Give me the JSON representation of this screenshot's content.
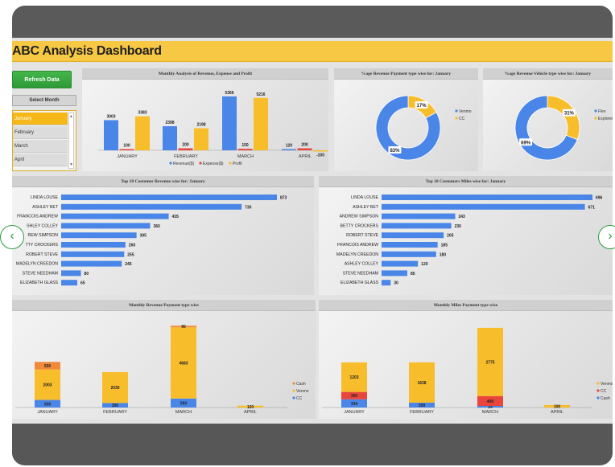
{
  "dashboard": {
    "title": "ABC Analysis Dashboard",
    "refresh_label": "Refresh Data",
    "select_month_label": "Select Month",
    "slicer_items": [
      "January",
      "February",
      "March",
      "April"
    ],
    "selected_month": "January"
  },
  "nav": {
    "prev_icon": "chevron-left-icon",
    "next_icon": "chevron-right-icon",
    "prev_glyph": "‹",
    "next_glyph": "›"
  },
  "colors": {
    "title_bar": "#f7c843",
    "blue": "#4a86e8",
    "yellow": "#f8bd2b",
    "red": "#e8453c",
    "orange": "#f08a3a",
    "green": "#3aa845"
  },
  "charts": {
    "monthly": {
      "title": "Monthly Analysis of Revenue, Expense and Profit",
      "type": "bar",
      "categories": [
        "JANUARY",
        "FEBRUARY",
        "MARCH",
        "APRIL"
      ],
      "series": [
        {
          "name": "Revenue($)",
          "values": [
            3003,
            2398,
            5366,
            120
          ],
          "labels": [
            "3003",
            "2398",
            "5366",
            "120"
          ]
        },
        {
          "name": "Expense($)",
          "values": [
            100,
            200,
            150,
            200
          ],
          "labels": [
            "100",
            "200",
            "150",
            "200"
          ]
        },
        {
          "name": "Profit",
          "values": [
            3383,
            2198,
            5216,
            -100
          ],
          "labels": [
            "3383",
            "2198",
            "5216",
            "-100"
          ]
        }
      ],
      "ylim": [
        -200,
        5600
      ]
    },
    "payment_donut": {
      "title": "%age Revenue Payment type wise for: January",
      "type": "pie",
      "slices": [
        {
          "name": "CC",
          "value": 17,
          "label": "17%"
        },
        {
          "name": "Venmo",
          "value": 83,
          "label": "83%"
        }
      ],
      "legend": [
        "Venmo",
        "CC"
      ]
    },
    "vehicle_donut": {
      "title": "%age Revenue Vehicle type wise for: January",
      "type": "pie",
      "slices": [
        {
          "name": "Explorer",
          "value": 31,
          "label": "31%"
        },
        {
          "name": "Flex",
          "value": 69,
          "label": "69%"
        }
      ],
      "legend": [
        "Flex",
        "Explorer"
      ]
    },
    "top_revenue": {
      "title": "Top 10 Customer Revenue wise for: January",
      "type": "bar",
      "categories": [
        "LINDA LOUSE",
        "ASHLEY BET",
        "FRANCOIS ANDREW",
        "ASHLEY COLLEY",
        "ANDREW SIMPSON",
        "BETTY CROCKERS",
        "ROBERT STEVE",
        "MADELYN CREEDON",
        "STEVE NEEDHAM",
        "ELIZABETH GLASS"
      ],
      "display_names": [
        "LINDA LOUSE",
        "ASHLEY BET",
        "FRANCOIS ANDREW",
        "SHLEY COLLEY",
        "REW SIMPSON",
        "TTY CROCKERS",
        "ROBERT STEVE",
        "MADELYN CREEDON",
        "STEVE NEEDHAM",
        "ELIZABETH GLASS"
      ],
      "values": [
        873,
        730,
        435,
        360,
        305,
        260,
        255,
        245,
        80,
        65
      ],
      "labels": [
        "873",
        "730",
        "435",
        "360",
        "305",
        "260",
        "255",
        "245",
        "80",
        "65"
      ]
    },
    "top_miles": {
      "title": "Top 10 Customers Miles wise for: January",
      "type": "bar",
      "categories": [
        "LINDA LOUSE",
        "ASHLEY BET",
        "ANDREW SIMPSON",
        "BETTY CROCKERS",
        "ROBERT STEVE",
        "FRANCOIS ANDREW",
        "MADELYN CREEDON",
        "ASHLEY COLLEY",
        "STEVE NEEDHAM",
        "ELIZABETH GLASS"
      ],
      "values": [
        696,
        671,
        243,
        230,
        205,
        185,
        180,
        120,
        85,
        30
      ],
      "labels": [
        "696",
        "671",
        "243",
        "230",
        "205",
        "185",
        "180",
        "120",
        "85",
        "30"
      ]
    },
    "rev_payment": {
      "title": "Monthly Revenue Payment type wise",
      "type": "bar",
      "categories": [
        "JANUARY",
        "FEBRUARY",
        "MARCH",
        "APRIL"
      ],
      "series": [
        {
          "name": "CC",
          "values": [
            500,
            300,
            593,
            0
          ],
          "labels": [
            "500",
            "300",
            "593",
            ""
          ]
        },
        {
          "name": "Venmo",
          "values": [
            2003,
            2030,
            4683,
            120
          ],
          "labels": [
            "2003",
            "2030",
            "4683",
            "120"
          ]
        },
        {
          "name": "Cash",
          "values": [
            500,
            0,
            90,
            0
          ],
          "labels": [
            "500",
            "",
            "90",
            ""
          ]
        }
      ],
      "legend": [
        "Cash",
        "Venmo",
        "CC"
      ],
      "ylim": [
        0,
        5500
      ]
    },
    "miles_payment": {
      "title": "Monthly Miles Payment type wise",
      "type": "bar",
      "categories": [
        "JANUARY",
        "FEBRUARY",
        "MARCH",
        "APRIL"
      ],
      "series": [
        {
          "name": "Cash",
          "values": [
            334,
            200,
            14,
            0
          ],
          "labels": [
            "334",
            "200",
            "14",
            ""
          ]
        },
        {
          "name": "CC",
          "values": [
            300,
            0,
            400,
            0
          ],
          "labels": [
            "300",
            "",
            "400",
            ""
          ]
        },
        {
          "name": "Venmo",
          "values": [
            1203,
            1638,
            2775,
            100
          ],
          "labels": [
            "1203",
            "1638",
            "2775",
            "100"
          ]
        }
      ],
      "legend": [
        "Venmo",
        "CC",
        "Cash"
      ],
      "ylim": [
        0,
        3400
      ]
    }
  }
}
